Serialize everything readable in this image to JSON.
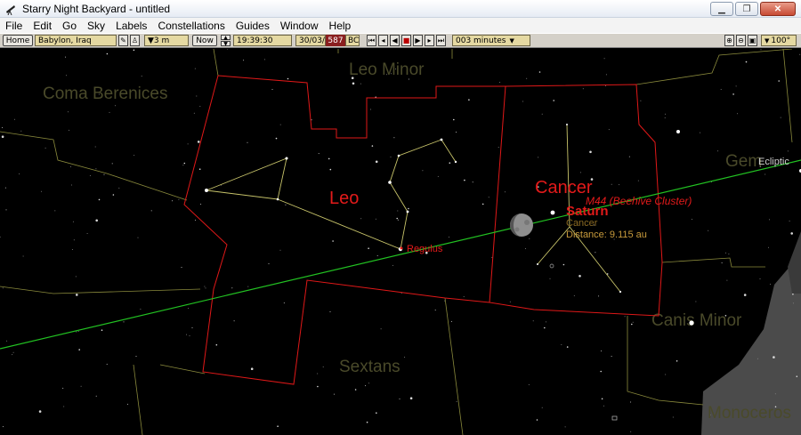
{
  "window": {
    "title": "Starry Night Backyard - untitled"
  },
  "menu": [
    "File",
    "Edit",
    "Go",
    "Sky",
    "Labels",
    "Constellations",
    "Guides",
    "Window",
    "Help"
  ],
  "toolbar": {
    "home": "Home",
    "location": "Babylon, Iraq",
    "elevation": "▼3 m",
    "now": "Now",
    "time": "19:39:30",
    "date": "30/03/",
    "year": "587",
    "era": "BC",
    "time_step": "003 minutes",
    "fov": "100°"
  },
  "sky": {
    "constellations": [
      "Leo Minor",
      "Coma Berenices",
      "Gem",
      "Canis Minor",
      "Sextans",
      "Monoceros"
    ],
    "highlighted": [
      "Leo",
      "Cancer"
    ],
    "labels": {
      "regulus": "Regulus",
      "ecliptic": "Ecliptic",
      "saturn": "Saturn",
      "cluster": "M44 (Beehive Cluster)",
      "info_const": "Cancer",
      "info_distance": "Distance: 9.115 au"
    }
  },
  "colors": {
    "boundary": "#e01818",
    "ecliptic": "#22c222",
    "stick": "#c8c46a",
    "faint_boundary": "#8a8a3c"
  }
}
